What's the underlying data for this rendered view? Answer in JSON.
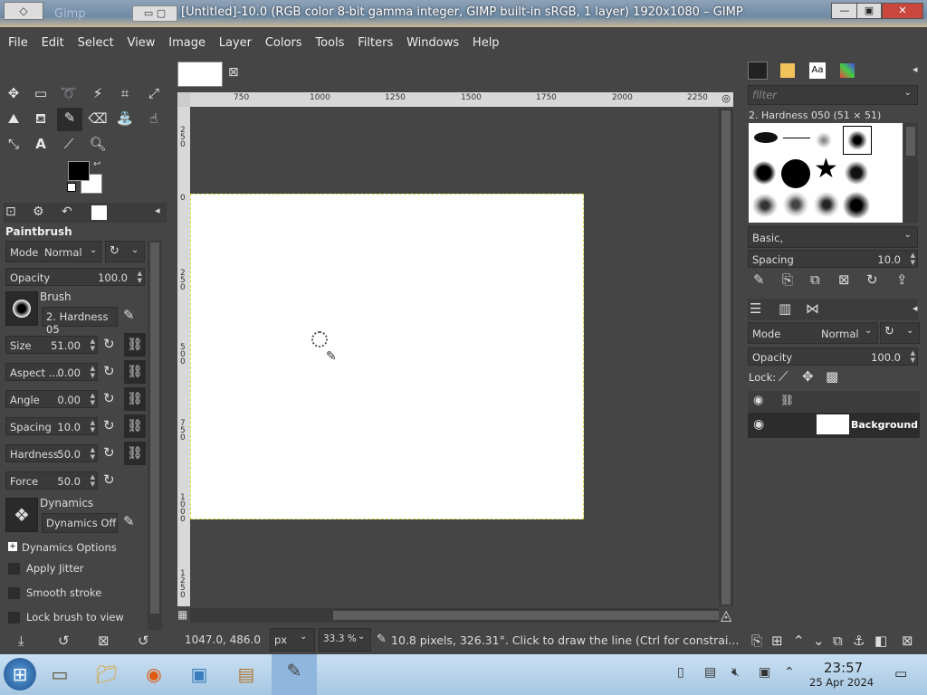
{
  "window": {
    "title": "[Untitled]-10.0 (RGB color 8-bit gamma integer, GIMP built-in sRGB, 1 layer) 1920x1080 – GIMP",
    "bg_title": "Gimp"
  },
  "menu": [
    "File",
    "Edit",
    "Select",
    "View",
    "Image",
    "Layer",
    "Colors",
    "Tools",
    "Filters",
    "Windows",
    "Help"
  ],
  "tool_options": {
    "title": "Paintbrush",
    "mode_label": "Mode",
    "mode_value": "Normal",
    "opacity_label": "Opacity",
    "opacity_value": "100.0",
    "brush_label": "Brush",
    "brush_value": "2. Hardness 05",
    "size_label": "Size",
    "size_value": "51.00",
    "aspect_label": "Aspect ...",
    "aspect_value": "0.00",
    "angle_label": "Angle",
    "angle_value": "0.00",
    "spacing_label": "Spacing",
    "spacing_value": "10.0",
    "hardness_label": "Hardness",
    "hardness_value": "50.0",
    "force_label": "Force",
    "force_value": "50.0",
    "dynamics_label": "Dynamics",
    "dynamics_value": "Dynamics Off",
    "dynamics_options": "Dynamics Options",
    "apply_jitter": "Apply Jitter",
    "smooth_stroke": "Smooth stroke",
    "lock_brush": "Lock brush to view"
  },
  "canvas": {
    "ruler_ticks": [
      "750",
      "1000",
      "1250",
      "1500",
      "1750",
      "2000",
      "2250"
    ],
    "vruler_ticks": [
      "2\n5\n0",
      "0",
      "2\n5\n0",
      "5\n0\n0",
      "7\n5\n0",
      "1\n0\n0\n0",
      "1\n2\n5\n0"
    ]
  },
  "statusbar": {
    "coords": "1047.0, 486.0",
    "unit": "px",
    "zoom": "33.3 %",
    "message": "10.8 pixels, 326.31°. Click to draw the line (Ctrl for constrai..."
  },
  "brushes": {
    "filter_placeholder": "filter",
    "selected_name": "2. Hardness 050 (51 × 51)",
    "tag": "Basic,",
    "spacing_label": "Spacing",
    "spacing_value": "10.0",
    "tab_text_icon": "Aa"
  },
  "layers": {
    "mode_label": "Mode",
    "mode_value": "Normal",
    "opacity_label": "Opacity",
    "opacity_value": "100.0",
    "lock_label": "Lock:",
    "layer_name": "Background"
  },
  "taskbar": {
    "time": "23:57",
    "date": "25 Apr 2024"
  },
  "colors": {
    "bg": "#454545",
    "panel_dark": "#2c2c2c",
    "canvas": "#ffffff",
    "taskbar": "#b4d0e8"
  }
}
